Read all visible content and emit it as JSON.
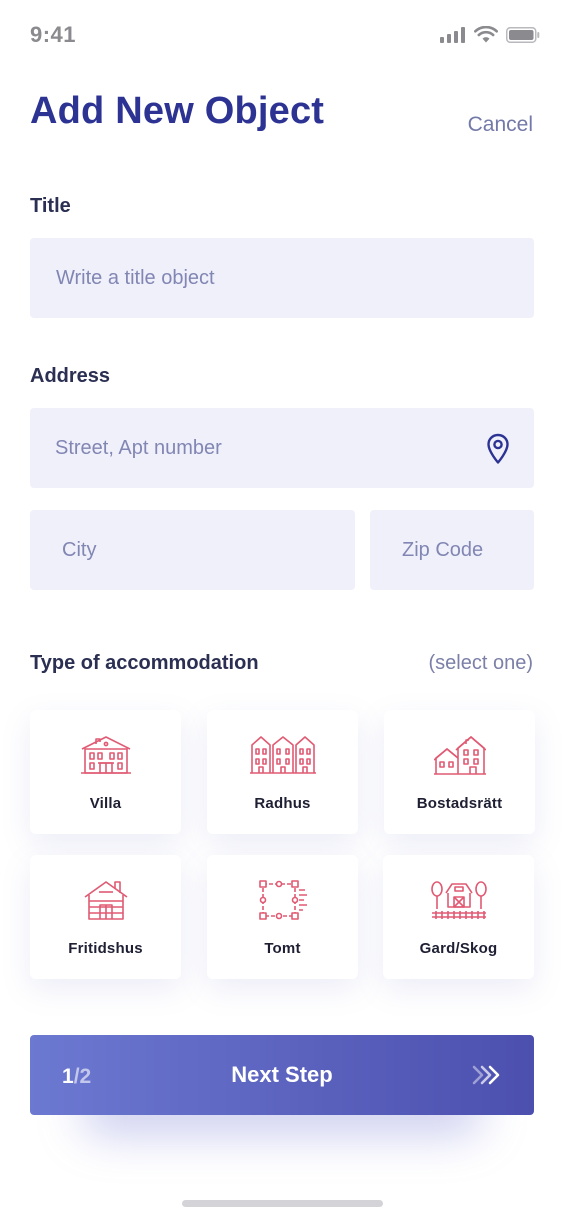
{
  "status_bar": {
    "time": "9:41"
  },
  "header": {
    "title": "Add New Object",
    "cancel_label": "Cancel"
  },
  "form": {
    "title_label": "Title",
    "title_placeholder": "Write a title object",
    "address_label": "Address",
    "street_placeholder": "Street, Apt number",
    "city_placeholder": "City",
    "zip_placeholder": "Zip Code"
  },
  "accommodation": {
    "label": "Type of accommodation",
    "hint": "(select one)",
    "options": [
      {
        "label": "Villa",
        "icon": "villa-icon"
      },
      {
        "label": "Radhus",
        "icon": "row-house-icon"
      },
      {
        "label": "Bostadsrätt",
        "icon": "apartment-icon"
      },
      {
        "label": "Fritidshus",
        "icon": "cabin-icon"
      },
      {
        "label": "Tomt",
        "icon": "plot-icon"
      },
      {
        "label": "Gard/Skog",
        "icon": "farm-icon"
      }
    ]
  },
  "footer": {
    "step_current": "1",
    "step_total": "/2",
    "next_label": "Next Step"
  },
  "colors": {
    "accent": "#2c3393",
    "icon_red": "#e05a73",
    "field_bg": "#f0f0fb"
  }
}
